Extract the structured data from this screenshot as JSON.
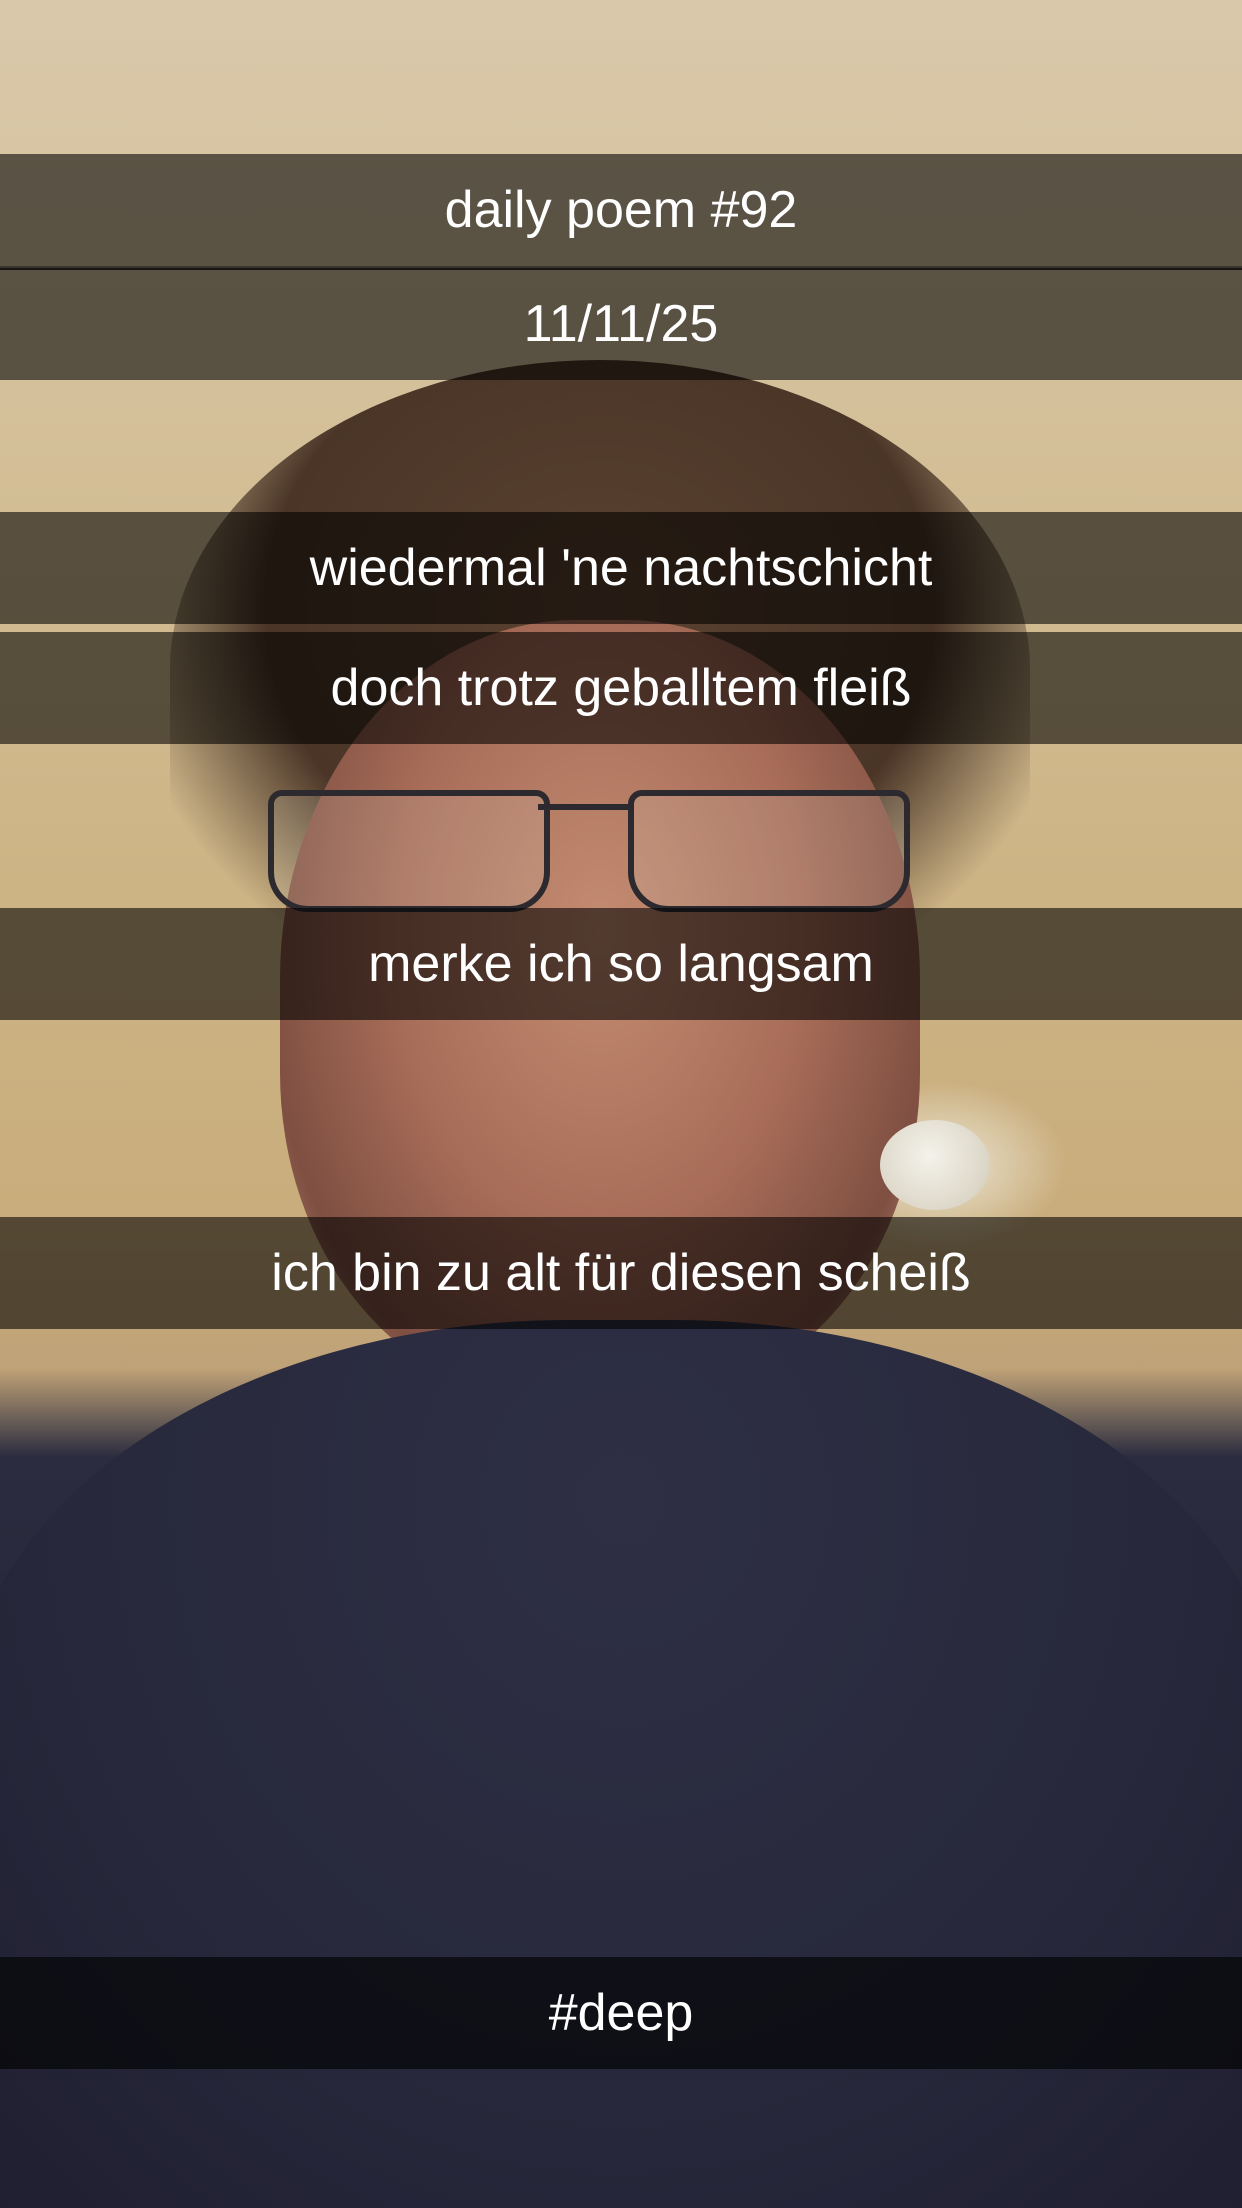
{
  "caption": {
    "title": "daily poem #92",
    "date": "11/11/25",
    "lines": [
      "wiedermal 'ne nachtschicht",
      "doch trotz geballtem fleiß",
      "merke ich so langsam",
      "ich bin zu alt für diesen scheiß"
    ],
    "hashtag": "#deep"
  }
}
